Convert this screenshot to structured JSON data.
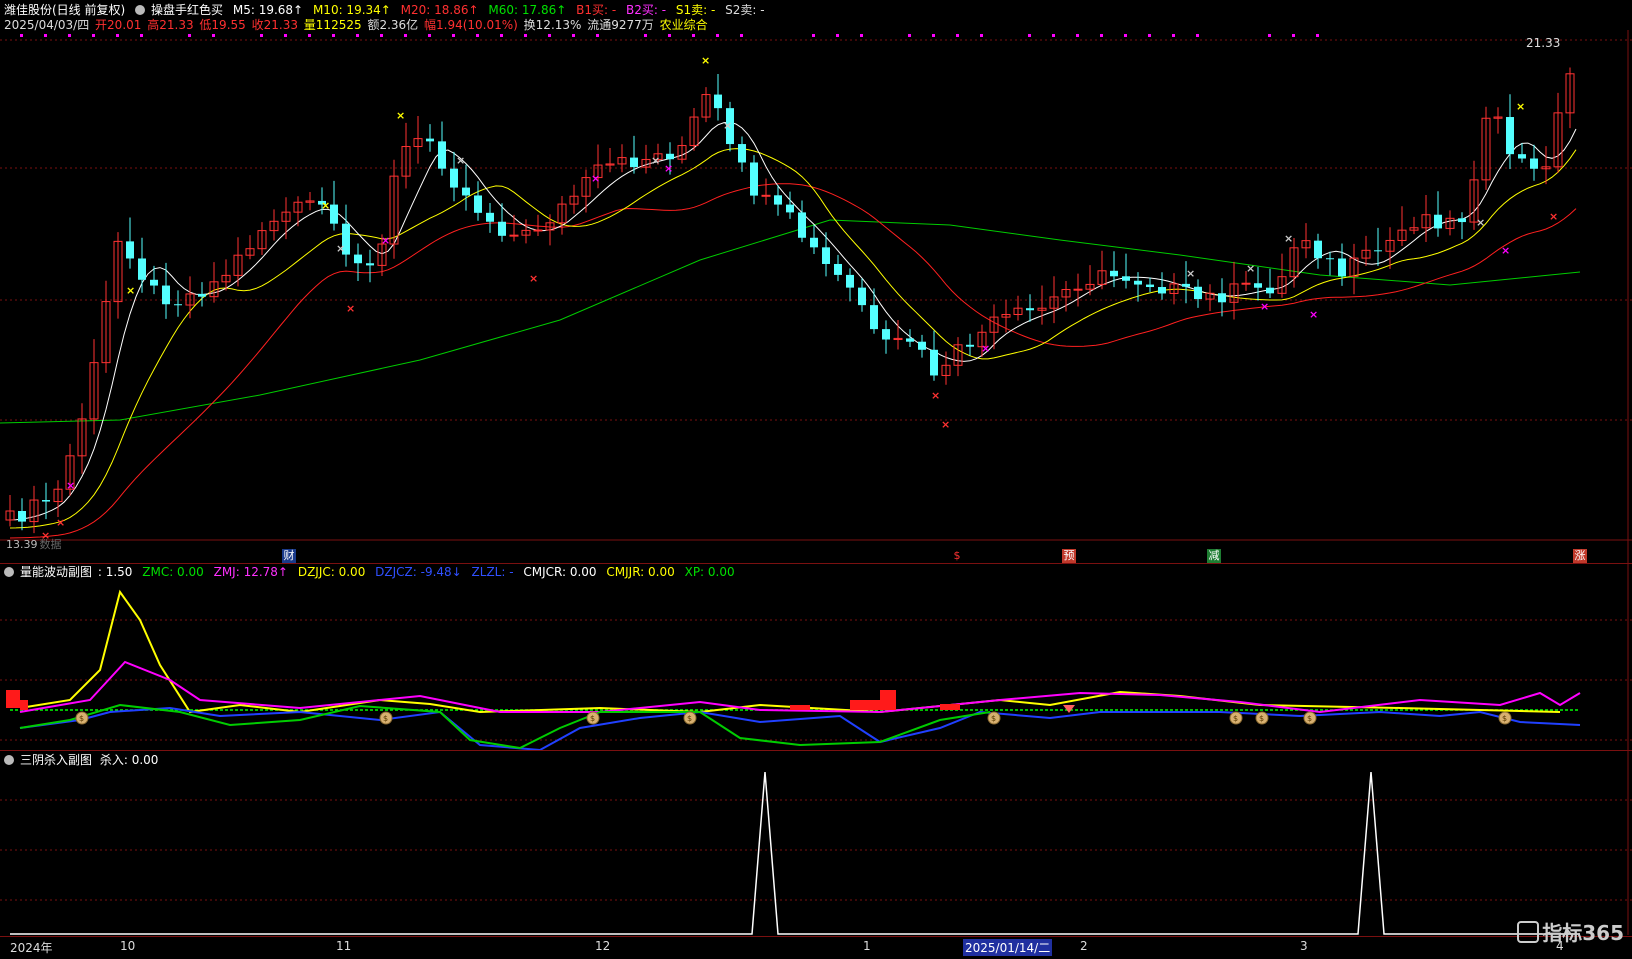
{
  "main_header": {
    "stock_name": "潍佳股份(日线 前复权)",
    "indicator": "操盘手红色买",
    "ma5": "M5: 19.68↑",
    "ma10": "M10: 19.34↑",
    "ma20": "M20: 18.86↑",
    "ma60": "M60: 17.86↑",
    "b1": "B1买: -",
    "b2": "B2买: -",
    "s1": "S1卖: -",
    "s2": "S2卖: -"
  },
  "quote_line": {
    "date": "2025/04/03/四",
    "open": "开20.01",
    "high": "高21.33",
    "low": "低19.55",
    "close": "收21.33",
    "volume": "量112525",
    "amount": "额2.36亿",
    "change": "幅1.94(10.01%)",
    "turnover": "换12.13%",
    "float": "流通9277万",
    "sector": "农业综合"
  },
  "price_labels": {
    "high_price": "21.33",
    "low_price": "13.39",
    "data_label": "数据"
  },
  "events": [
    {
      "label": "财",
      "color": "#1a3a8a"
    },
    {
      "label": "$",
      "color": "#000000",
      "text_color": "#ff3333"
    },
    {
      "label": "预",
      "color": "#c0392b"
    },
    {
      "label": "减",
      "color": "#1e7d32"
    },
    {
      "label": "涨",
      "color": "#c0392b"
    }
  ],
  "panel2": {
    "title": "量能波动副图",
    "value": ": 1.50",
    "zmc": "ZMC: 0.00",
    "zmj": "ZMJ: 12.78↑",
    "dzjjc": "DZJJC: 0.00",
    "dzjcz": "DZJCZ: -9.48↓",
    "zlzl": "ZLZL: -",
    "cmjcr": "CMJCR: 0.00",
    "cmjjr": "CMJJR: 0.00",
    "xp": "XP: 0.00"
  },
  "panel3": {
    "title": "三阴杀入副图",
    "value": "杀入: 0.00"
  },
  "x_axis": {
    "year": "2024年",
    "m10": "10",
    "m11": "11",
    "m12": "12",
    "m1": "1",
    "cursor_date": "2025/01/14/二",
    "m2": "2",
    "m3": "3",
    "m4": "4"
  },
  "logo": "指标365",
  "colors": {
    "up": "#ff3232",
    "down": "#54ffff",
    "ma5": "#ffffff",
    "ma10": "#ffff00",
    "ma20": "#ff2020",
    "ma60": "#00cc00",
    "grid": "#7a1010",
    "magenta": "#ff00ff",
    "blue": "#2040ff"
  }
}
